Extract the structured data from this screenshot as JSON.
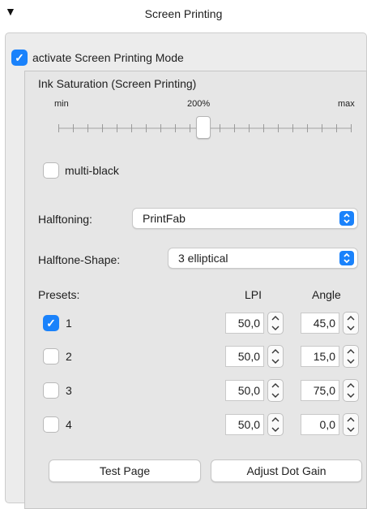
{
  "header": {
    "title": "Screen Printing",
    "disclosure_icon": "disclosure-triangle-down"
  },
  "activate": {
    "label": "activate Screen Printing Mode",
    "checked": true
  },
  "ink": {
    "title": "Ink Saturation (Screen Printing)",
    "min_label": "min",
    "mid_label": "200%",
    "max_label": "max"
  },
  "multi_black": {
    "label": "multi-black",
    "checked": false
  },
  "halftoning": {
    "label": "Halftoning:",
    "value": "PrintFab"
  },
  "halftone_shape": {
    "label": "Halftone-Shape:",
    "value": "3 elliptical"
  },
  "presets": {
    "label": "Presets:",
    "lpi_header": "LPI",
    "angle_header": "Angle",
    "rows": [
      {
        "name": "1",
        "checked": true,
        "lpi": "50,0",
        "angle": "45,0"
      },
      {
        "name": "2",
        "checked": false,
        "lpi": "50,0",
        "angle": "15,0"
      },
      {
        "name": "3",
        "checked": false,
        "lpi": "50,0",
        "angle": "75,0"
      },
      {
        "name": "4",
        "checked": false,
        "lpi": "50,0",
        "angle": "0,0"
      }
    ]
  },
  "buttons": {
    "test_page": "Test Page",
    "adjust_dot_gain": "Adjust Dot Gain"
  },
  "colors": {
    "accent": "#1a82fb",
    "panel": "#ececec",
    "inner_panel": "#e6e6e6"
  }
}
